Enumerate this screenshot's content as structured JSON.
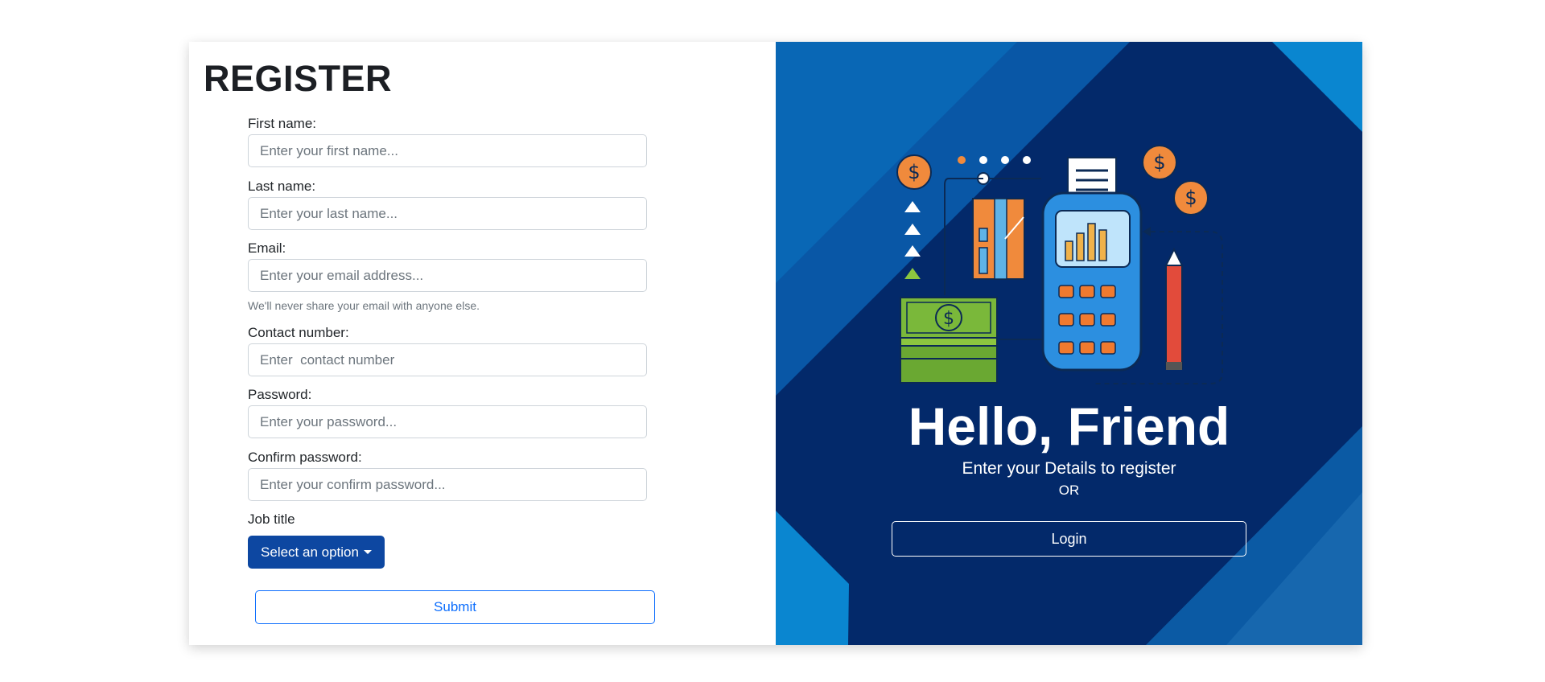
{
  "form": {
    "title": "REGISTER",
    "fields": [
      {
        "label": "First name:",
        "placeholder": "Enter your first name..."
      },
      {
        "label": "Last name:",
        "placeholder": "Enter your last name..."
      },
      {
        "label": "Email:",
        "placeholder": "Enter your email address..."
      },
      {
        "label": "Contact number:",
        "placeholder": "Enter  contact number"
      },
      {
        "label": "Password:",
        "placeholder": "Enter your password..."
      },
      {
        "label": "Confirm password:",
        "placeholder": "Enter your confirm password..."
      }
    ],
    "email_help": "We'll never share your email with anyone else.",
    "job_title_label": "Job title",
    "job_title_button": "Select an option",
    "submit_label": "Submit"
  },
  "hero": {
    "heading": "Hello, Friend",
    "subtitle": "Enter your Details to register",
    "or_text": "OR",
    "login_label": "Login",
    "illustration_icon": "payment-terminal-finance-illustration"
  },
  "colors": {
    "primary": "#0d6efd",
    "dropdown_bg": "#0d47a1",
    "panel_bg": "#03296a",
    "panel_accent": "#0a86d0"
  }
}
